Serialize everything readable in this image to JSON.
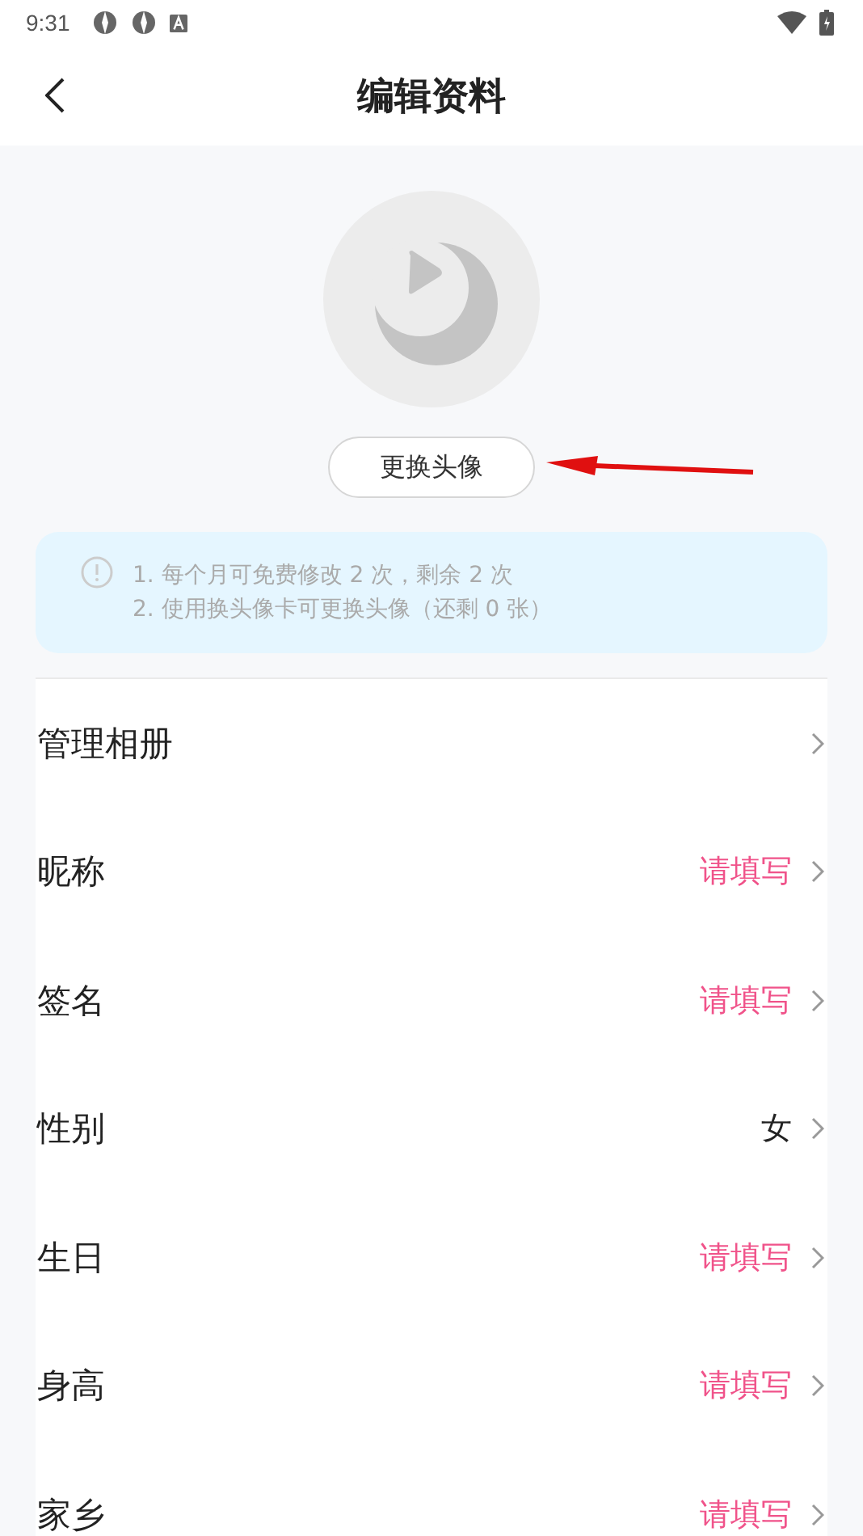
{
  "status_bar": {
    "time": "9:31"
  },
  "header": {
    "title": "编辑资料"
  },
  "avatar": {
    "button": "更换头像"
  },
  "notice": {
    "lines": [
      "1. 每个月可免费修改 2 次，剩余 2 次",
      "2. 使用换头像卡可更换头像（还剩 0 张）"
    ]
  },
  "fields": [
    {
      "label": "管理相册",
      "kind": "link"
    },
    {
      "label": "昵称",
      "value": "请填写",
      "kind": "empty"
    },
    {
      "label": "签名",
      "value": "请填写",
      "kind": "empty"
    },
    {
      "label": "性别",
      "value": "女",
      "kind": "filled"
    },
    {
      "label": "生日",
      "value": "请填写",
      "kind": "empty"
    },
    {
      "label": "身高",
      "value": "请填写",
      "kind": "empty"
    },
    {
      "label": "家乡",
      "value": "请填写",
      "kind": "empty"
    }
  ]
}
